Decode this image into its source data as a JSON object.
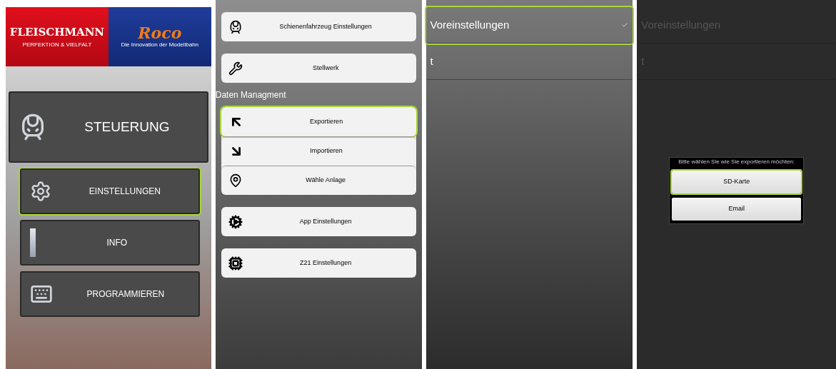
{
  "screens": [
    {
      "kind": "main_menu",
      "logos": [
        {
          "name": "FLEISCHMANN",
          "tagline": "PERFEKTION & VIELFALT"
        },
        {
          "name": "Roco",
          "tagline": "Die Innovation der Modellbahn"
        }
      ],
      "buttons": [
        {
          "label": "STEUERUNG",
          "highlighted": false
        },
        {
          "label": "EINSTELLUNGEN",
          "highlighted": true
        },
        {
          "label": "INFO",
          "highlighted": false
        },
        {
          "label": "PROGRAMMIEREN",
          "highlighted": false
        }
      ]
    },
    {
      "kind": "settings_menu",
      "sections": [
        {
          "kind": "card",
          "items": [
            {
              "label": "Schienenfahrzeug Einstellungen",
              "highlighted": false
            }
          ]
        },
        {
          "kind": "card",
          "items": [
            {
              "label": "Stellwerk",
              "highlighted": false
            }
          ]
        },
        {
          "kind": "heading",
          "label": "Daten Managment"
        },
        {
          "kind": "card",
          "items": [
            {
              "label": "Exportieren",
              "highlighted": true
            },
            {
              "label": "Importieren",
              "highlighted": false
            },
            {
              "label": "Wähle Anlage",
              "highlighted": false
            }
          ]
        },
        {
          "kind": "card",
          "items": [
            {
              "label": "App Einstellungen",
              "highlighted": false
            }
          ]
        },
        {
          "kind": "card",
          "items": [
            {
              "label": "Z21 Einstellungen",
              "highlighted": false
            }
          ]
        }
      ]
    },
    {
      "kind": "list",
      "items": [
        {
          "label": "Voreinstellungen",
          "checked": true,
          "highlighted": true
        },
        {
          "label": "t",
          "checked": false,
          "highlighted": false
        }
      ]
    },
    {
      "kind": "dialog",
      "items": [
        {
          "label": "Voreinstellungen"
        },
        {
          "label": "t"
        }
      ],
      "dialog": {
        "message": "Bitte wählen Sie wie Sie exportieren möchten:",
        "buttons": [
          {
            "label": "SD-Karte",
            "highlighted": true
          },
          {
            "label": "Email",
            "highlighted": false
          }
        ]
      }
    }
  ]
}
